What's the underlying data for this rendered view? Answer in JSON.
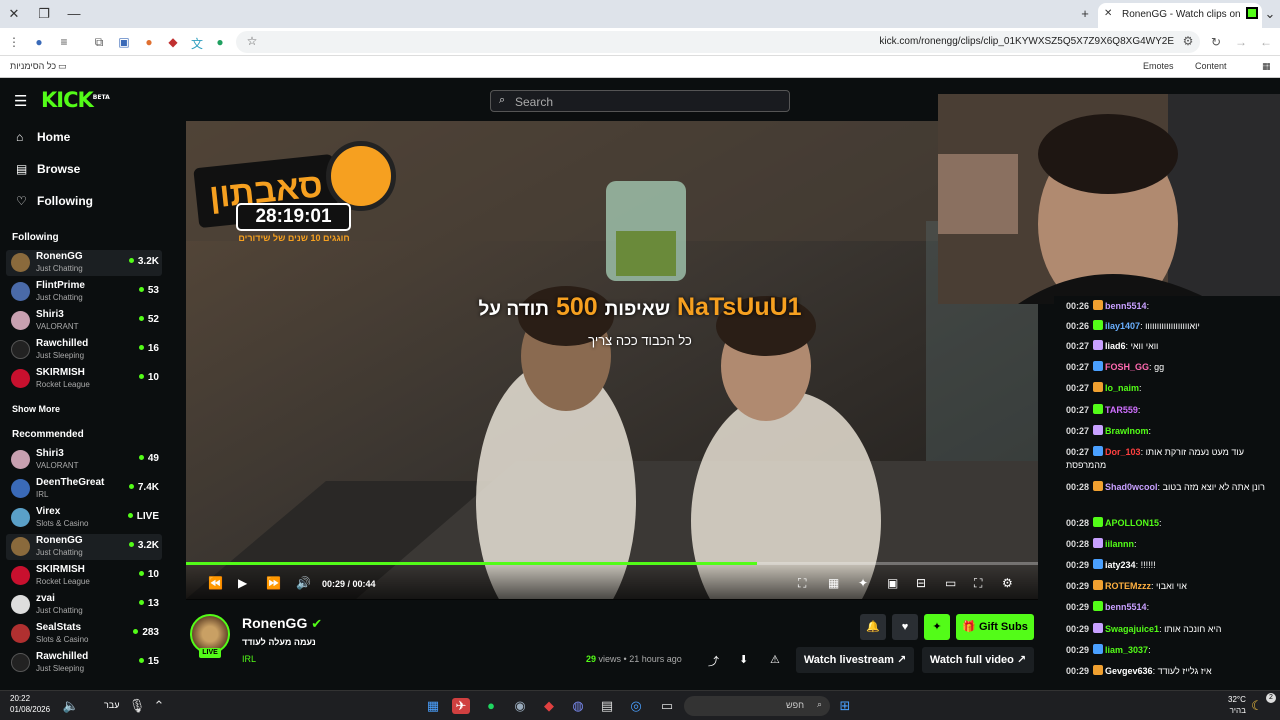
{
  "browser": {
    "tab_title": "RonenGG - Watch clips on",
    "url": "kick.com/ronengg/clips/clip_01KYWXSZ5Q5X7Z9X6Q8XG4WY2E",
    "bookmarks_all": "כל הסימניות",
    "bookmark_emotes": "Emotes",
    "bookmark_content": "Content"
  },
  "kick": {
    "logo": "KICK",
    "logo_badge": "BETA",
    "search_placeholder": "Search",
    "nav": [
      {
        "label": "Home"
      },
      {
        "label": "Browse"
      },
      {
        "label": "Following"
      }
    ],
    "following_title": "Following",
    "following": [
      {
        "name": "RonenGG",
        "category": "Just Chatting",
        "viewers": "3.2K",
        "color": "#8a6a3c"
      },
      {
        "name": "FlintPrime",
        "category": "Just Chatting",
        "viewers": "53",
        "color": "#4a6aa8"
      },
      {
        "name": "Shiri3",
        "category": "VALORANT",
        "viewers": "52",
        "color": "#c8a0b0"
      },
      {
        "name": "Rawchilled",
        "category": "Just Sleeping",
        "viewers": "16",
        "color": "#222222"
      },
      {
        "name": "SKIRMISH",
        "category": "Rocket League",
        "viewers": "10",
        "color": "#c8102e"
      }
    ],
    "show_more": "Show More",
    "recommended_title": "Recommended",
    "recommended": [
      {
        "name": "Shiri3",
        "category": "VALORANT",
        "viewers": "49",
        "color": "#c8a0b0"
      },
      {
        "name": "DeenTheGreat",
        "category": "IRL",
        "viewers": "7.4K",
        "color": "#3a6ab8"
      },
      {
        "name": "Virex",
        "category": "Slots & Casino",
        "viewers": "LIVE",
        "color": "#5aa0c8"
      },
      {
        "name": "RonenGG",
        "category": "Just Chatting",
        "viewers": "3.2K",
        "color": "#8a6a3c"
      },
      {
        "name": "SKIRMISH",
        "category": "Rocket League",
        "viewers": "10",
        "color": "#c8102e"
      },
      {
        "name": "zvai",
        "category": "Just Chatting",
        "viewers": "13",
        "color": "#dddddd"
      },
      {
        "name": "SealStats",
        "category": "Slots & Casino",
        "viewers": "283",
        "color": "#b03030"
      },
      {
        "name": "Rawchilled",
        "category": "Just Sleeping",
        "viewers": "15",
        "color": "#222222"
      }
    ]
  },
  "video": {
    "overlay_title": "סאבתון",
    "overlay_timer": "28:19:01",
    "overlay_sub": "חוגגים 10 שנים של שידורים",
    "alert_main_user": "NaTsUuU1",
    "alert_main_amount": "500",
    "alert_main_text1": "תודה על",
    "alert_main_text2": "שאיפות",
    "alert_sub": "כל הכבוד ככה צריך",
    "current_time": "00:29",
    "duration": "00:44",
    "progress": 0.67
  },
  "chat": [
    {
      "time": "00:26",
      "user": "benn5514",
      "color": "#c8a0ff",
      "text": ""
    },
    {
      "time": "00:26",
      "user": "ilay1407",
      "color": "#6ab0ff",
      "text": "יואווווווווווווווווווו"
    },
    {
      "time": "00:27",
      "user": "liad6",
      "color": "#ffffff",
      "text": "וואי וואי"
    },
    {
      "time": "00:27",
      "user": "FOSH_GG",
      "color": "#ff6ab0",
      "text": "gg"
    },
    {
      "time": "00:27",
      "user": "Io_naim",
      "color": "#53fc18",
      "text": ""
    },
    {
      "time": "00:27",
      "user": "TAR559",
      "color": "#d070ff",
      "text": ""
    },
    {
      "time": "00:27",
      "user": "BrawInom",
      "color": "#53fc18",
      "text": ""
    },
    {
      "time": "00:27",
      "user": "Dor_103",
      "color": "#ff4040",
      "text": "עוד מעט נעמה זורקת אותו מהמרפסת"
    },
    {
      "time": "00:28",
      "user": "Shad0wcool",
      "color": "#c8a0ff",
      "text": "רונן אתה לא יוצא מזה בטוב"
    },
    {
      "time": "00:28",
      "user": "APOLLON15",
      "color": "#53fc18",
      "text": ""
    },
    {
      "time": "00:28",
      "user": "iilannn",
      "color": "#53fc18",
      "text": ""
    },
    {
      "time": "00:29",
      "user": "iaty234",
      "color": "#ffffff",
      "text": "!!!!!!"
    },
    {
      "time": "00:29",
      "user": "ROTEMzzz",
      "color": "#ffb040",
      "text": "אוי ואבוי"
    },
    {
      "time": "00:29",
      "user": "benn5514",
      "color": "#c8a0ff",
      "text": ""
    },
    {
      "time": "00:29",
      "user": "Swagajuice1",
      "color": "#53fc18",
      "text": "היא חונכה אותו"
    },
    {
      "time": "00:29",
      "user": "liam_3037",
      "color": "#53fc18",
      "text": ""
    },
    {
      "time": "00:29",
      "user": "Gevgev636",
      "color": "#ffffff",
      "text": "איז גלייז לעודד"
    }
  ],
  "channel": {
    "name": "RonenGG",
    "title": "נעמה מעלה לעודד",
    "category": "IRL",
    "live_label": "LIVE",
    "views": "29",
    "views_label": "views",
    "time_ago": "21 hours ago",
    "gift_subs": "Gift Subs",
    "watch_livestream": "Watch livestream",
    "watch_full_video": "Watch full video"
  },
  "taskbar": {
    "time": "20:22",
    "date": "01/08/2026",
    "lang": "עבר",
    "search": "חפש",
    "weather_temp": "32°C",
    "weather_desc": "בהיר",
    "notifications": "2"
  },
  "colors": {
    "accent": "#53fc18",
    "bg": "#0b0e0f"
  }
}
